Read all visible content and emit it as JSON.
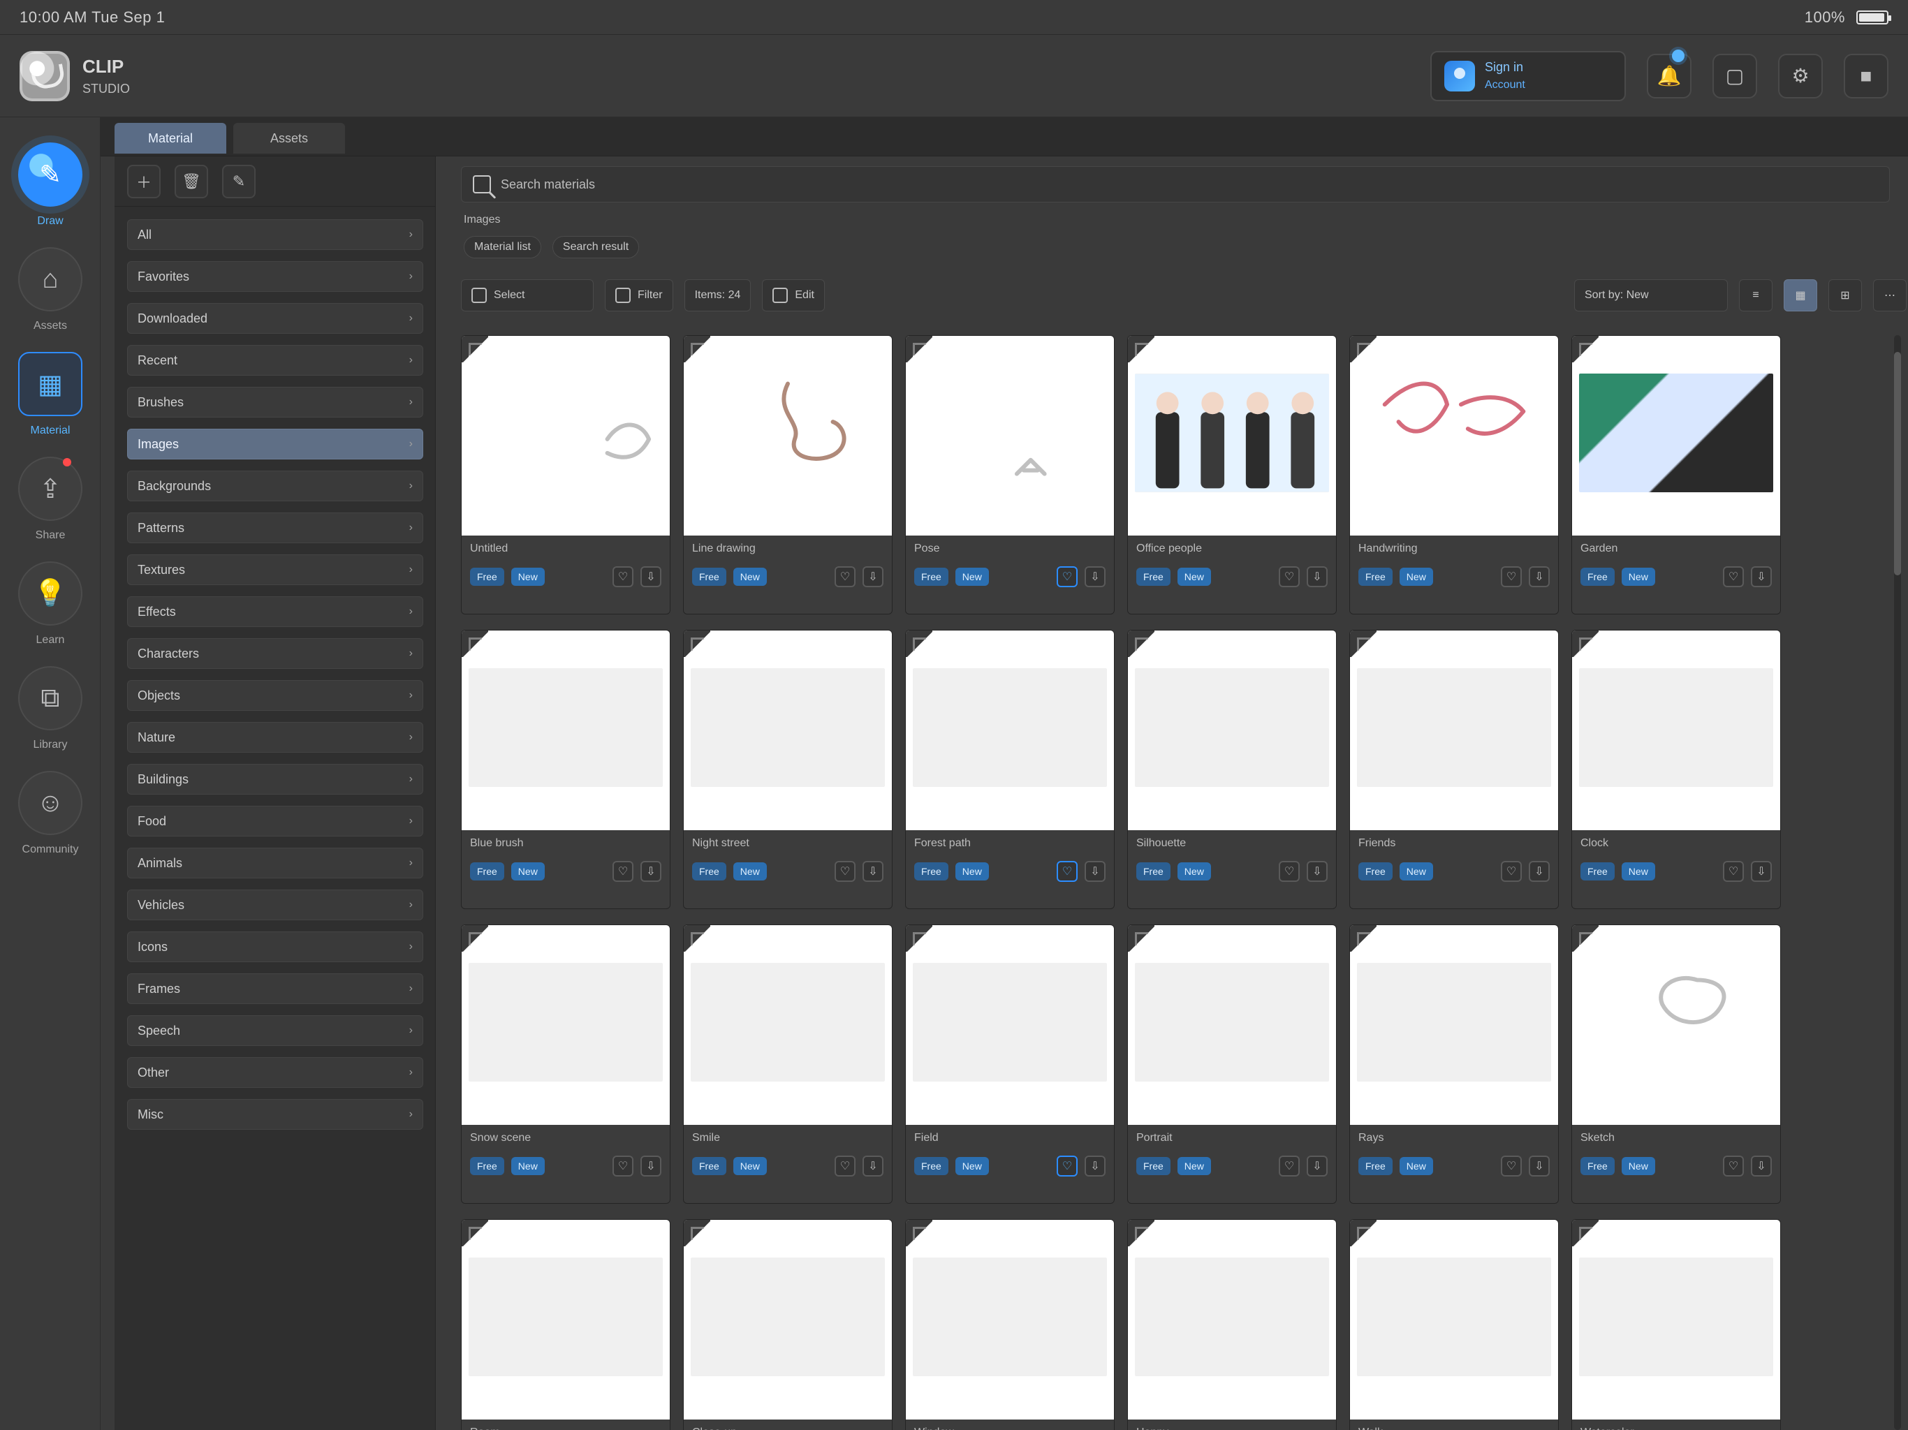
{
  "statusbar": {
    "left_text": "10:00 AM  Tue Sep 1",
    "right_text": "100%"
  },
  "app": {
    "logo_line1": "CLIP",
    "logo_line2": "STUDIO"
  },
  "header": {
    "account_line1": "Sign in",
    "account_line2": "Account"
  },
  "rail": {
    "items": [
      {
        "label": "Draw",
        "icon": "pencil-icon"
      },
      {
        "label": "Assets",
        "icon": "store-icon"
      },
      {
        "label": "Material",
        "icon": "material-icon"
      },
      {
        "label": "Share",
        "icon": "share-icon"
      },
      {
        "label": "Learn",
        "icon": "bulb-icon"
      },
      {
        "label": "Library",
        "icon": "library-icon"
      },
      {
        "label": "Community",
        "icon": "community-icon"
      }
    ]
  },
  "tabs": {
    "items": [
      {
        "label": "Material"
      },
      {
        "label": "Assets"
      }
    ]
  },
  "folders": {
    "items": [
      {
        "label": "All"
      },
      {
        "label": "Favorites"
      },
      {
        "label": "Downloaded"
      },
      {
        "label": "Recent"
      },
      {
        "label": "Brushes"
      },
      {
        "label": "Images"
      },
      {
        "label": "Backgrounds"
      },
      {
        "label": "Patterns"
      },
      {
        "label": "Textures"
      },
      {
        "label": "Effects"
      },
      {
        "label": "Characters"
      },
      {
        "label": "Objects"
      },
      {
        "label": "Nature"
      },
      {
        "label": "Buildings"
      },
      {
        "label": "Food"
      },
      {
        "label": "Animals"
      },
      {
        "label": "Vehicles"
      },
      {
        "label": "Icons"
      },
      {
        "label": "Frames"
      },
      {
        "label": "Speech"
      },
      {
        "label": "Other"
      },
      {
        "label": "Misc"
      }
    ],
    "selected_index": 5
  },
  "content": {
    "search_placeholder": "Search materials",
    "crumb_top": "Images",
    "crumb_chips": [
      {
        "label": "Material list"
      },
      {
        "label": "Search result"
      }
    ],
    "toolbar": {
      "select_label": "Select",
      "filter_label": "Filter",
      "count_label": "Items: 24",
      "edit_label": "Edit",
      "sort_label": "Sort by: New"
    }
  },
  "cards": [
    {
      "title": "Untitled",
      "art": "sketch-pink"
    },
    {
      "title": "Line drawing",
      "art": "sketch-brown"
    },
    {
      "title": "Pose",
      "art": "sketch-grey"
    },
    {
      "title": "Office people",
      "art": "people"
    },
    {
      "title": "Handwriting",
      "art": "sketch-red"
    },
    {
      "title": "Garden",
      "art": "garden"
    },
    {
      "title": "Blue brush",
      "art": "blue"
    },
    {
      "title": "Night street",
      "art": "night"
    },
    {
      "title": "Forest path",
      "art": "green"
    },
    {
      "title": "Silhouette",
      "art": "pink"
    },
    {
      "title": "Friends",
      "art": "mix"
    },
    {
      "title": "Clock",
      "art": "clock"
    },
    {
      "title": "Snow scene",
      "art": "grey"
    },
    {
      "title": "Smile",
      "art": "pink"
    },
    {
      "title": "Field",
      "art": "leaf"
    },
    {
      "title": "Portrait",
      "art": "green"
    },
    {
      "title": "Rays",
      "art": "cyan"
    },
    {
      "title": "Sketch",
      "art": "sketch-light"
    },
    {
      "title": "Room",
      "art": "purple"
    },
    {
      "title": "Close-up",
      "art": "pink"
    },
    {
      "title": "Window",
      "art": "aqua"
    },
    {
      "title": "Happy",
      "art": "yellow"
    },
    {
      "title": "Walk",
      "art": "mix"
    },
    {
      "title": "Watercolor",
      "art": "wash"
    }
  ],
  "tags": {
    "tag1": "Free",
    "tag2": "New"
  }
}
